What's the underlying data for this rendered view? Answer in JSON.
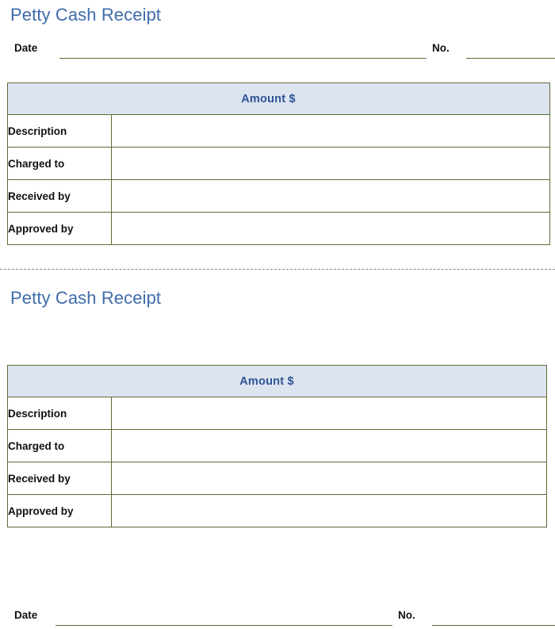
{
  "document": {
    "type": "petty-cash-receipt-form",
    "accent_title_color": "#3f6bab",
    "header_fill_color": "#dce4f0",
    "header_text_color": "#2e5395",
    "border_color": "#5d6b33",
    "rule_color": "#5d6b33",
    "separator_color": "#8b8b8b"
  },
  "receipts": [
    {
      "title": "Petty Cash Receipt",
      "meta": {
        "date_label": "Date",
        "date_value": "",
        "no_label": "No.",
        "no_value": ""
      },
      "table": {
        "amount_header": "Amount $",
        "rows": [
          {
            "label": "Description",
            "value": ""
          },
          {
            "label": "Charged to",
            "value": ""
          },
          {
            "label": "Received by",
            "value": ""
          },
          {
            "label": "Approved by",
            "value": ""
          }
        ]
      }
    },
    {
      "title": "Petty Cash Receipt",
      "meta": {
        "date_label": "Date",
        "date_value": "",
        "no_label": "No.",
        "no_value": ""
      },
      "table": {
        "amount_header": "Amount $",
        "rows": [
          {
            "label": "Description",
            "value": ""
          },
          {
            "label": "Charged to",
            "value": ""
          },
          {
            "label": "Received by",
            "value": ""
          },
          {
            "label": "Approved by",
            "value": ""
          }
        ]
      }
    }
  ]
}
